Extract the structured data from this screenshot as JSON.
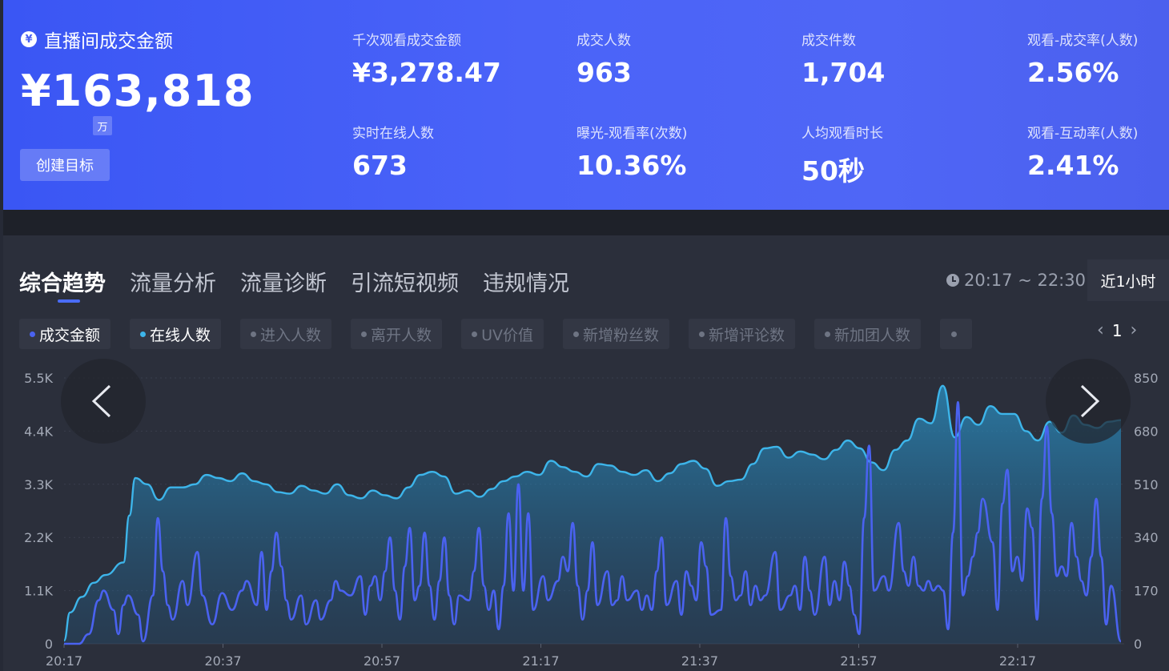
{
  "summary": {
    "main_label": "直播间成交金额",
    "main_value": "¥163,818",
    "unit": "万",
    "goal_button": "创建目标",
    "metrics": [
      {
        "label": "千次观看成交金额",
        "value": "¥3,278.47"
      },
      {
        "label": "成交人数",
        "value": "963"
      },
      {
        "label": "成交件数",
        "value": "1,704"
      },
      {
        "label": "观看-成交率(人数)",
        "value": "2.56%"
      },
      {
        "label": "实时在线人数",
        "value": "673"
      },
      {
        "label": "曝光-观看率(次数)",
        "value": "10.36%"
      },
      {
        "label": "人均观看时长",
        "value": "50秒"
      },
      {
        "label": "观看-互动率(人数)",
        "value": "2.41%"
      }
    ]
  },
  "tabs": [
    "综合趋势",
    "流量分析",
    "流量诊断",
    "引流短视频",
    "违规情况"
  ],
  "time_range": "20:17 ~ 22:30",
  "range_button": "近1小时",
  "chips": [
    "成交金额",
    "在线人数",
    "进入人数",
    "离开人数",
    "UV价值",
    "新增粉丝数",
    "新增评论数",
    "新加团人数"
  ],
  "page": "1",
  "icons": {
    "currency": "yuan-icon",
    "clock": "clock-icon",
    "prev": "chevron-left-icon",
    "next": "chevron-right-icon"
  },
  "colors": {
    "accent_blue": "#4a62f0",
    "line_cyan": "#3db5ea"
  },
  "chart_data": {
    "type": "area",
    "x_ticks": [
      "20:17",
      "20:37",
      "20:57",
      "21:17",
      "21:37",
      "21:57",
      "22:17"
    ],
    "x_range": [
      "20:17",
      "22:30"
    ],
    "y_left": {
      "ticks": [
        "5.5K",
        "4.4K",
        "3.3K",
        "2.2K",
        "1.1K",
        "0"
      ],
      "range": [
        0,
        5500
      ]
    },
    "y_right": {
      "ticks": [
        "850",
        "680",
        "510",
        "340",
        "170",
        "0"
      ],
      "range": [
        0,
        850
      ]
    },
    "grid": true,
    "series": [
      {
        "name": "在线人数",
        "axis": "right",
        "color": "#3db5ea",
        "points": [
          [
            0,
            10
          ],
          [
            1,
            100
          ],
          [
            3,
            150
          ],
          [
            5,
            195
          ],
          [
            7,
            220
          ],
          [
            10,
            260
          ],
          [
            11,
            410
          ],
          [
            12,
            530
          ],
          [
            14,
            510
          ],
          [
            16,
            460
          ],
          [
            18,
            500
          ],
          [
            20,
            500
          ],
          [
            22,
            510
          ],
          [
            24,
            540
          ],
          [
            26,
            530
          ],
          [
            28,
            520
          ],
          [
            30,
            545
          ],
          [
            32,
            520
          ],
          [
            34,
            510
          ],
          [
            36,
            485
          ],
          [
            38,
            480
          ],
          [
            40,
            505
          ],
          [
            42,
            490
          ],
          [
            44,
            480
          ],
          [
            46,
            510
          ],
          [
            48,
            475
          ],
          [
            50,
            465
          ],
          [
            52,
            490
          ],
          [
            54,
            475
          ],
          [
            56,
            465
          ],
          [
            58,
            500
          ],
          [
            60,
            540
          ],
          [
            62,
            550
          ],
          [
            64,
            535
          ],
          [
            66,
            480
          ],
          [
            68,
            490
          ],
          [
            70,
            470
          ],
          [
            72,
            495
          ],
          [
            74,
            520
          ],
          [
            76,
            535
          ],
          [
            78,
            550
          ],
          [
            80,
            540
          ],
          [
            82,
            585
          ],
          [
            84,
            565
          ],
          [
            86,
            550
          ],
          [
            88,
            535
          ],
          [
            90,
            575
          ],
          [
            92,
            570
          ],
          [
            94,
            550
          ],
          [
            96,
            540
          ],
          [
            98,
            555
          ],
          [
            100,
            520
          ],
          [
            102,
            545
          ],
          [
            104,
            575
          ],
          [
            106,
            585
          ],
          [
            108,
            560
          ],
          [
            110,
            505
          ],
          [
            112,
            520
          ],
          [
            114,
            525
          ],
          [
            116,
            575
          ],
          [
            118,
            625
          ],
          [
            120,
            630
          ],
          [
            122,
            595
          ],
          [
            124,
            615
          ],
          [
            126,
            605
          ],
          [
            128,
            590
          ],
          [
            130,
            620
          ],
          [
            132,
            650
          ],
          [
            134,
            625
          ],
          [
            136,
            580
          ],
          [
            138,
            555
          ],
          [
            140,
            620
          ],
          [
            142,
            650
          ],
          [
            144,
            720
          ],
          [
            146,
            705
          ],
          [
            148,
            825
          ],
          [
            150,
            660
          ],
          [
            152,
            725
          ],
          [
            154,
            700
          ],
          [
            156,
            760
          ],
          [
            158,
            735
          ],
          [
            160,
            735
          ],
          [
            162,
            680
          ],
          [
            164,
            650
          ],
          [
            166,
            710
          ],
          [
            168,
            675
          ],
          [
            170,
            730
          ],
          [
            172,
            700
          ],
          [
            174,
            690
          ],
          [
            176,
            710
          ],
          [
            178,
            715
          ]
        ]
      },
      {
        "name": "成交金额",
        "axis": "left",
        "color": "#4a62f0",
        "points": [
          [
            0,
            0
          ],
          [
            3,
            0
          ],
          [
            5,
            200
          ],
          [
            7,
            900
          ],
          [
            8,
            1100
          ],
          [
            10,
            700
          ],
          [
            11,
            200
          ],
          [
            12,
            800
          ],
          [
            13,
            1000
          ],
          [
            15,
            600
          ],
          [
            16,
            50
          ],
          [
            18,
            1000
          ],
          [
            19,
            2600
          ],
          [
            20,
            1500
          ],
          [
            21,
            800
          ],
          [
            22,
            500
          ],
          [
            24,
            1300
          ],
          [
            25,
            800
          ],
          [
            27,
            1900
          ],
          [
            28,
            1000
          ],
          [
            30,
            400
          ],
          [
            32,
            1050
          ],
          [
            34,
            700
          ],
          [
            36,
            1100
          ],
          [
            37,
            1300
          ],
          [
            39,
            800
          ],
          [
            40,
            1900
          ],
          [
            41,
            700
          ],
          [
            42,
            1500
          ],
          [
            43,
            2300
          ],
          [
            44,
            1600
          ],
          [
            45,
            900
          ],
          [
            46,
            500
          ],
          [
            48,
            1000
          ],
          [
            49,
            400
          ],
          [
            51,
            900
          ],
          [
            52,
            500
          ],
          [
            54,
            900
          ],
          [
            55,
            1300
          ],
          [
            56,
            1100
          ],
          [
            58,
            1000
          ],
          [
            60,
            1400
          ],
          [
            61,
            600
          ],
          [
            62,
            1200
          ],
          [
            63,
            1400
          ],
          [
            64,
            900
          ],
          [
            65,
            1500
          ],
          [
            66,
            2200
          ],
          [
            67,
            1100
          ],
          [
            68,
            500
          ],
          [
            69,
            1600
          ],
          [
            70,
            2400
          ],
          [
            71,
            900
          ],
          [
            72,
            1200
          ],
          [
            73,
            2300
          ],
          [
            74,
            1200
          ],
          [
            75,
            500
          ],
          [
            76,
            1300
          ],
          [
            77,
            2200
          ],
          [
            78,
            1000
          ],
          [
            79,
            400
          ],
          [
            80,
            1000
          ],
          [
            82,
            900
          ],
          [
            83,
            1500
          ],
          [
            84,
            2400
          ],
          [
            85,
            1200
          ],
          [
            86,
            700
          ],
          [
            87,
            1100
          ],
          [
            88,
            300
          ],
          [
            89,
            1200
          ],
          [
            90,
            2700
          ],
          [
            91,
            1100
          ],
          [
            92,
            3300
          ],
          [
            93,
            1100
          ],
          [
            94,
            2700
          ],
          [
            95,
            700
          ],
          [
            97,
            1400
          ],
          [
            98,
            900
          ],
          [
            100,
            1300
          ],
          [
            101,
            1800
          ],
          [
            102,
            1500
          ],
          [
            103,
            2500
          ],
          [
            104,
            1200
          ],
          [
            105,
            500
          ],
          [
            106,
            1100
          ],
          [
            107,
            2100
          ],
          [
            108,
            800
          ],
          [
            110,
            1500
          ],
          [
            111,
            800
          ],
          [
            112,
            900
          ],
          [
            113,
            1400
          ],
          [
            114,
            900
          ],
          [
            116,
            1100
          ],
          [
            117,
            700
          ],
          [
            118,
            1000
          ],
          [
            119,
            700
          ],
          [
            120,
            1500
          ],
          [
            121,
            2200
          ],
          [
            122,
            800
          ],
          [
            124,
            1300
          ],
          [
            125,
            600
          ],
          [
            126,
            1500
          ],
          [
            127,
            1200
          ],
          [
            128,
            900
          ],
          [
            129,
            2100
          ],
          [
            130,
            1600
          ],
          [
            131,
            600
          ],
          [
            133,
            700
          ],
          [
            134,
            2600
          ],
          [
            135,
            1400
          ],
          [
            136,
            900
          ],
          [
            137,
            1000
          ],
          [
            138,
            1500
          ],
          [
            139,
            800
          ],
          [
            140,
            1200
          ],
          [
            141,
            900
          ],
          [
            142,
            1000
          ],
          [
            144,
            1900
          ],
          [
            145,
            700
          ],
          [
            147,
            1000
          ],
          [
            148,
            1200
          ],
          [
            149,
            700
          ],
          [
            150,
            1800
          ],
          [
            151,
            1100
          ],
          [
            152,
            600
          ],
          [
            154,
            1800
          ],
          [
            155,
            800
          ],
          [
            156,
            1300
          ],
          [
            157,
            900
          ],
          [
            158,
            1700
          ],
          [
            159,
            1200
          ],
          [
            160,
            600
          ],
          [
            161,
            200
          ],
          [
            162,
            2600
          ],
          [
            163,
            4100
          ],
          [
            164,
            1100
          ],
          [
            166,
            1400
          ],
          [
            167,
            1100
          ],
          [
            169,
            2500
          ],
          [
            170,
            1500
          ],
          [
            171,
            1200
          ],
          [
            172,
            1800
          ],
          [
            173,
            1200
          ],
          [
            174,
            1100
          ],
          [
            175,
            1300
          ],
          [
            176,
            1100
          ],
          [
            177,
            1200
          ],
          [
            178,
            1100
          ],
          [
            179,
            300
          ],
          [
            180,
            2300
          ],
          [
            181,
            5000
          ],
          [
            182,
            1000
          ],
          [
            183,
            1400
          ],
          [
            184,
            1800
          ],
          [
            185,
            2300
          ],
          [
            186,
            3000
          ],
          [
            188,
            2100
          ],
          [
            189,
            700
          ],
          [
            190,
            2900
          ],
          [
            191,
            3600
          ],
          [
            192,
            1500
          ],
          [
            193,
            1800
          ],
          [
            194,
            1300
          ],
          [
            195,
            2800
          ],
          [
            196,
            2400
          ],
          [
            197,
            500
          ],
          [
            198,
            3000
          ],
          [
            199,
            4500
          ],
          [
            200,
            2700
          ],
          [
            201,
            1400
          ],
          [
            202,
            1600
          ],
          [
            203,
            1400
          ],
          [
            204,
            2500
          ],
          [
            205,
            1800
          ],
          [
            206,
            1300
          ],
          [
            207,
            1000
          ],
          [
            208,
            1800
          ],
          [
            209,
            3000
          ],
          [
            210,
            1800
          ],
          [
            211,
            400
          ],
          [
            212,
            1200
          ],
          [
            214,
            50
          ]
        ]
      }
    ]
  }
}
